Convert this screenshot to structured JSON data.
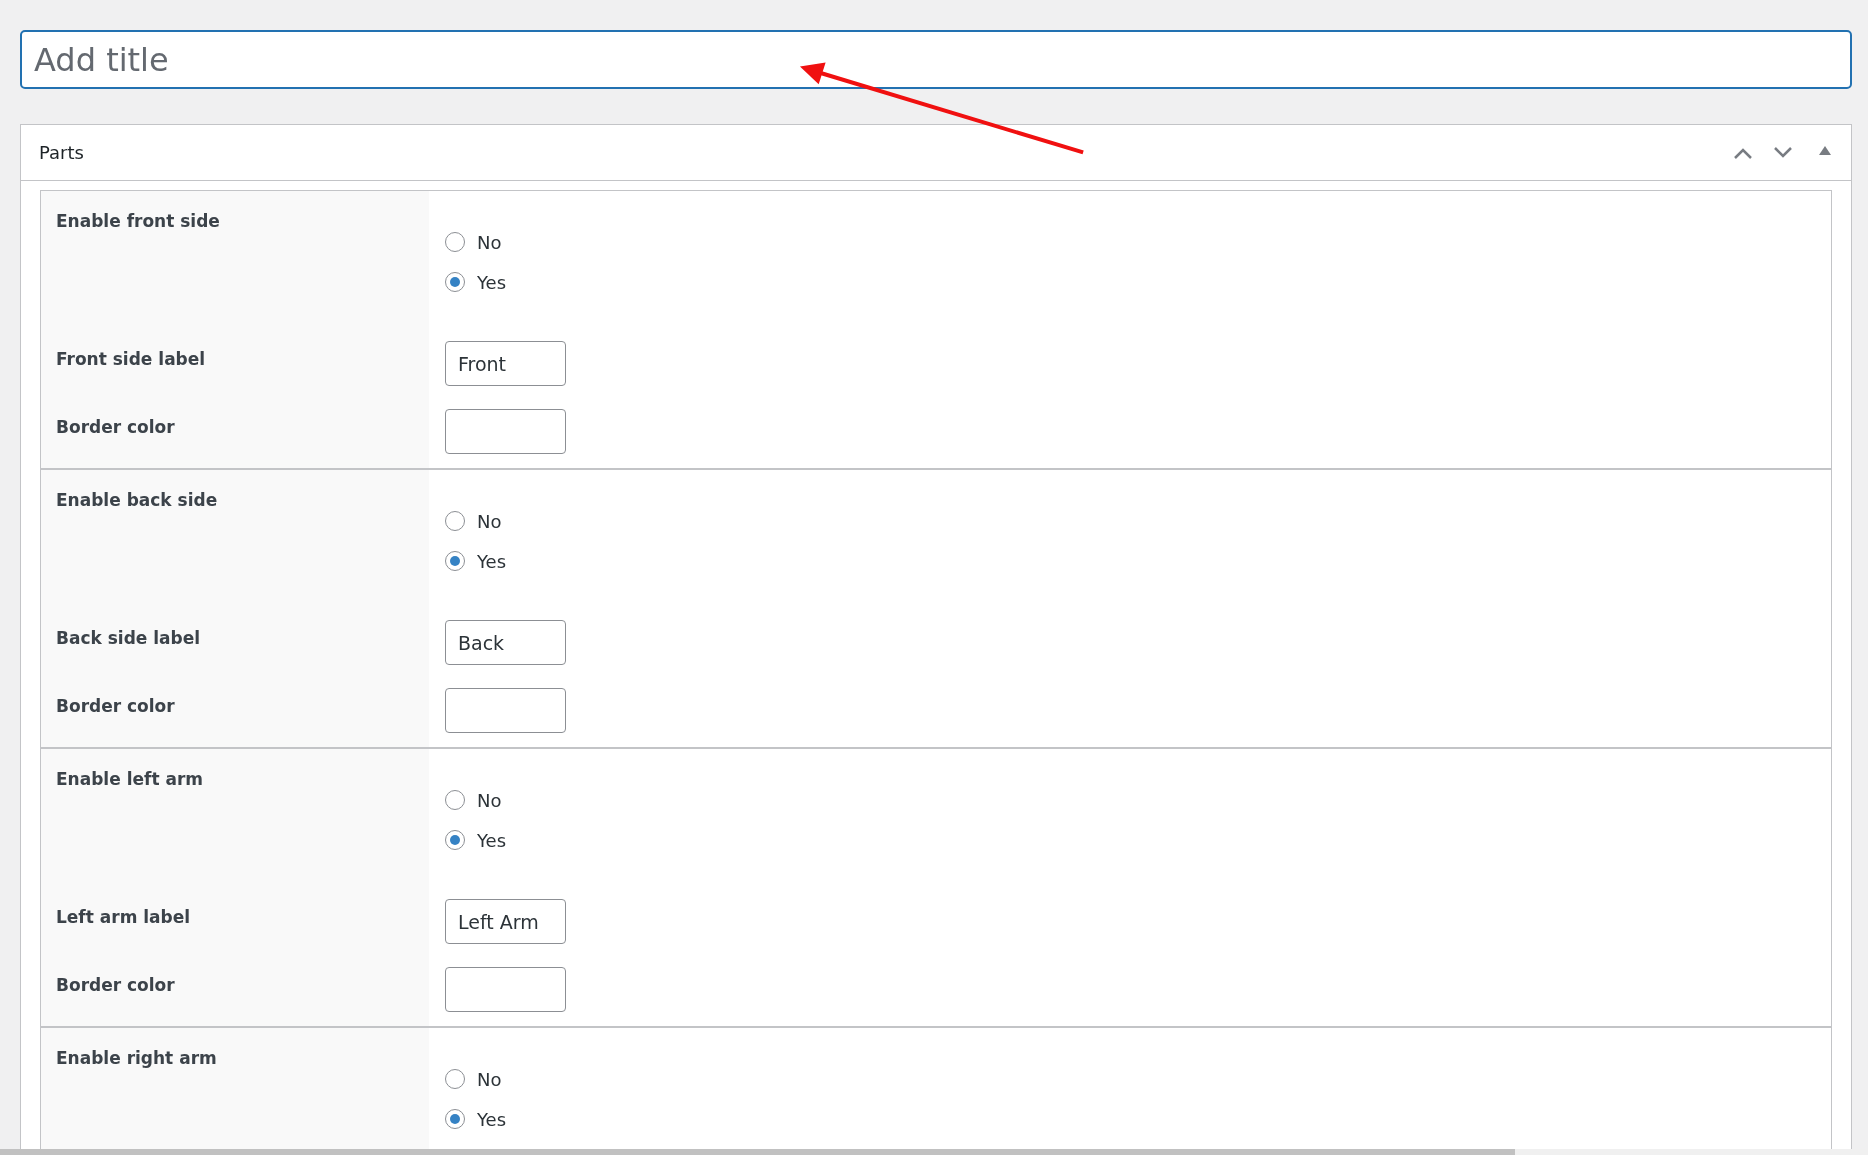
{
  "title_field": {
    "placeholder": "Add title"
  },
  "panel": {
    "title": "Parts",
    "sections": [
      {
        "fields": [
          {
            "kind": "radio",
            "label": "Enable front side",
            "options": [
              {
                "label": "No",
                "selected": false
              },
              {
                "label": "Yes",
                "selected": true
              }
            ]
          },
          {
            "kind": "text",
            "label": "Front side label",
            "value": "Front"
          },
          {
            "kind": "text",
            "label": "Border color"
          }
        ]
      },
      {
        "fields": [
          {
            "kind": "radio",
            "label": "Enable back side",
            "options": [
              {
                "label": "No",
                "selected": false
              },
              {
                "label": "Yes",
                "selected": true
              }
            ]
          },
          {
            "kind": "text",
            "label": "Back side label",
            "value": "Back"
          },
          {
            "kind": "text",
            "label": "Border color"
          }
        ]
      },
      {
        "fields": [
          {
            "kind": "radio",
            "label": "Enable left arm",
            "options": [
              {
                "label": "No",
                "selected": false
              },
              {
                "label": "Yes",
                "selected": true
              }
            ]
          },
          {
            "kind": "text",
            "label": "Left arm label",
            "value": "Left Arm"
          },
          {
            "kind": "text",
            "label": "Border color"
          }
        ]
      },
      {
        "fields": [
          {
            "kind": "radio",
            "label": "Enable right arm",
            "options": [
              {
                "label": "No",
                "selected": false
              },
              {
                "label": "Yes",
                "selected": true
              }
            ]
          }
        ]
      }
    ]
  }
}
